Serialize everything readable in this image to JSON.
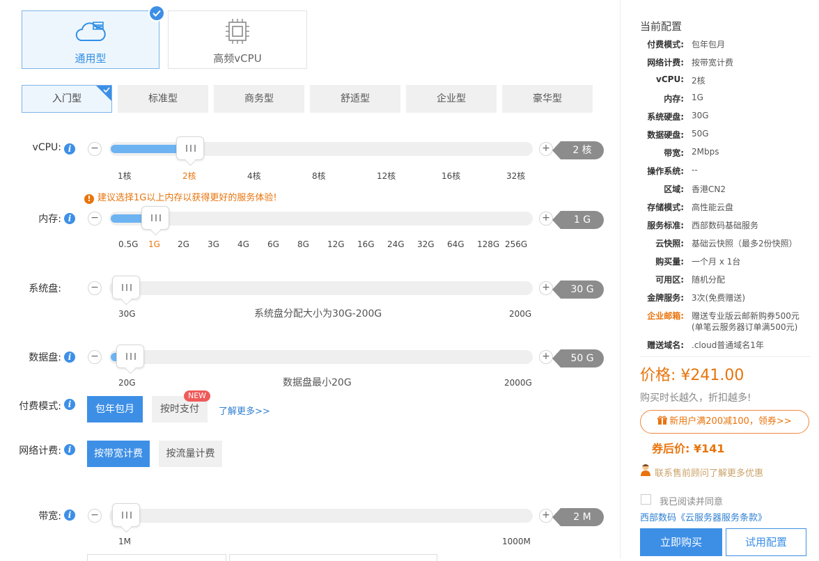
{
  "instance_types": [
    {
      "label": "通用型",
      "icon": "cloud-server-icon",
      "selected": true
    },
    {
      "label": "高频vCPU",
      "icon": "cpu-chip-icon",
      "selected": false
    }
  ],
  "tiers": [
    {
      "label": "入门型",
      "selected": true
    },
    {
      "label": "标准型",
      "selected": false
    },
    {
      "label": "商务型",
      "selected": false
    },
    {
      "label": "舒适型",
      "selected": false
    },
    {
      "label": "企业型",
      "selected": false
    },
    {
      "label": "豪华型",
      "selected": false
    }
  ],
  "vcpu": {
    "label": "vCPU:",
    "value_tag": "2 核",
    "ticks": [
      "1核",
      "2核",
      "4核",
      "8核",
      "12核",
      "16核",
      "32核"
    ],
    "selected_index": 1
  },
  "memory_warning": "建议选择1G以上内存以获得更好的服务体验!",
  "memory": {
    "label": "内存:",
    "value_tag": "1 G",
    "ticks": [
      "0.5G",
      "1G",
      "2G",
      "3G",
      "4G",
      "6G",
      "8G",
      "12G",
      "16G",
      "24G",
      "32G",
      "64G",
      "128G",
      "256G"
    ],
    "selected_index": 1
  },
  "system_disk": {
    "label": "系统盘:",
    "value_tag": "30 G",
    "min_label": "30G",
    "max_label": "200G",
    "hint": "系统盘分配大小为30G-200G"
  },
  "data_disk": {
    "label": "数据盘:",
    "value_tag": "50 G",
    "min_label": "20G",
    "max_label": "2000G",
    "hint": "数据盘最小20G"
  },
  "billing_mode": {
    "label": "付费模式:",
    "options": [
      "包年包月",
      "按时支付"
    ],
    "selected_index": 0,
    "new_badge": "NEW",
    "more_link": "了解更多>>"
  },
  "network_billing": {
    "label": "网络计费:",
    "options": [
      "按带宽计费",
      "按流量计费"
    ],
    "selected_index": 0
  },
  "bandwidth": {
    "label": "带宽:",
    "value_tag": "2 M",
    "min_label": "1M",
    "max_label": "1000M"
  },
  "summary": {
    "title": "当前配置",
    "specs": [
      {
        "key": "付费模式:",
        "value": "包年包月"
      },
      {
        "key": "网络计费:",
        "value": "按带宽计费"
      },
      {
        "key": "vCPU:",
        "value": "2核"
      },
      {
        "key": "内存:",
        "value": "1G"
      },
      {
        "key": "系统硬盘:",
        "value": "30G"
      },
      {
        "key": "数据硬盘:",
        "value": "50G"
      },
      {
        "key": "带宽:",
        "value": "2Mbps"
      },
      {
        "key": "操作系统:",
        "value": "--"
      },
      {
        "key": "区域:",
        "value": "香港CN2"
      },
      {
        "key": "存储模式:",
        "value": "高性能云盘"
      },
      {
        "key": "服务标准:",
        "value": "西部数码基础服务"
      },
      {
        "key": "云快照:",
        "value": "基础云快照（最多2份快照）"
      },
      {
        "key": "购买量:",
        "value": "一个月 x 1台"
      },
      {
        "key": "可用区:",
        "value": "随机分配"
      },
      {
        "key": "金牌服务:",
        "value": "3次(免费赠送)"
      }
    ],
    "enterprise_mail": {
      "key": "企业邮箱:",
      "line1": "赠送专业版云邮新购券500元",
      "line2": "(单笔云服务器订单满500元)"
    },
    "gift_domain": {
      "key": "赠送域名:",
      "value": ".cloud普通域名1年"
    },
    "price": "价格: ¥241.00",
    "price_sub": "购买时长越久，折扣越多!",
    "coupon": "新用户满200减100，领券>>",
    "after_coupon": "券后价: ¥141",
    "contact": "联系售前顾问了解更多优惠",
    "agree_text": "我已阅读并同意",
    "terms_link": "西部数码《云服务器服务条款》",
    "buy_button": "立即购买",
    "trial_button": "试用配置"
  },
  "colors": {
    "accent": "#3d8fe6",
    "orange": "#e8740c",
    "tag_gray": "#8c8c8c"
  }
}
